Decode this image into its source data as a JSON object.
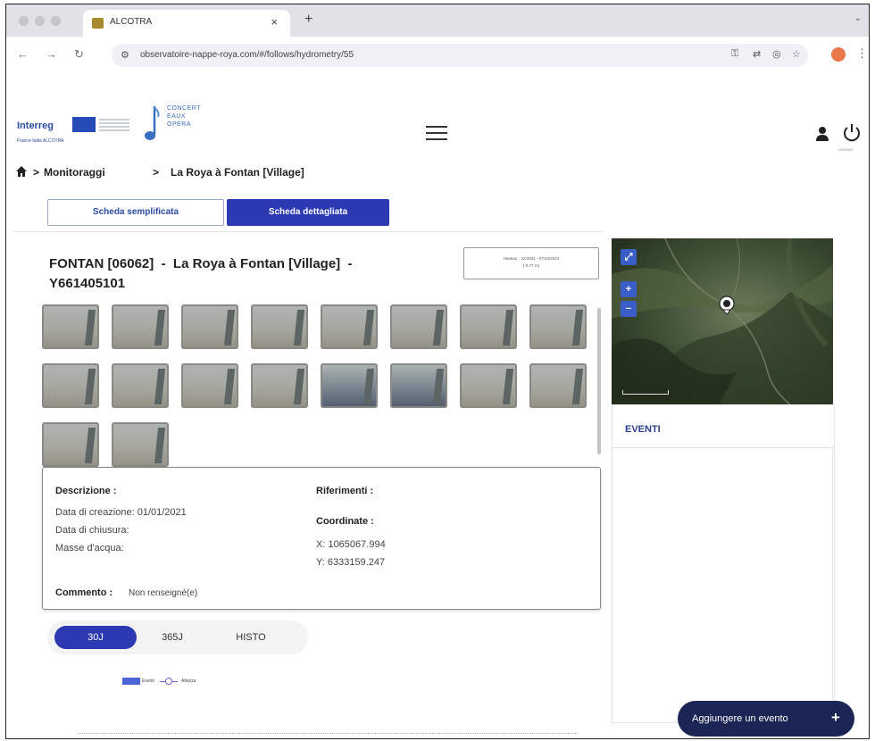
{
  "browser": {
    "tab_title": "ALCOTRA",
    "tab_close": "×",
    "new_tab": "+",
    "url": "observatoire-nappe-roya.com/#/follows/hydrometry/55"
  },
  "header": {
    "interreg_label": "Interreg",
    "interreg_sub": "France-Italia ALCOTRA",
    "concert_lines": [
      "CONCERT",
      "EAUX",
      "OPERA"
    ],
    "logout_label": "LOGOUT"
  },
  "breadcrumb": {
    "sep": ">",
    "items": [
      "Monitoraggi",
      "La Roya à Fontan [Village]"
    ]
  },
  "tabs": {
    "simple": "Scheda semplificata",
    "detailed": "Scheda dettagliata"
  },
  "station": {
    "title_line1": "FONTAN [06062]  -  La Roya à Fontan [Village]  -",
    "title_line2": "Y661405101",
    "hauteur_line1": "Hauteur : 22/2021 - 07/10/2024",
    "hauteur_line2": "(-0.77 m)"
  },
  "photos": {
    "dark_indices": [
      12,
      13
    ]
  },
  "description": {
    "descrizione_label": "Descrizione :",
    "creazione": "Data di creazione:  01/01/2021",
    "chiusura": "Data di chiusura:",
    "masse": "Masse d'acqua:",
    "riferimenti_label": "Riferimenti :",
    "coordinate_label": "Coordinate :",
    "x": "X:  1065067.994",
    "y": "Y:  6333159.247",
    "commento_label": "Commento :",
    "commento_value": "Non renseigné(e)"
  },
  "ranges": {
    "options": [
      "30J",
      "365J",
      "HISTO"
    ],
    "active": "30J"
  },
  "legend": {
    "eventi": "Eventi",
    "altezza": "Altezza"
  },
  "map": {
    "expand": "⤢",
    "zoom_in": "+",
    "zoom_out": "−"
  },
  "eventi": {
    "title": "EVENTI",
    "add_button": "Aggiungere un evento",
    "add_icon": "+"
  },
  "colors": {
    "primary": "#2b39b3",
    "navy": "#1b2554",
    "title_blue": "#2b3f8f"
  }
}
